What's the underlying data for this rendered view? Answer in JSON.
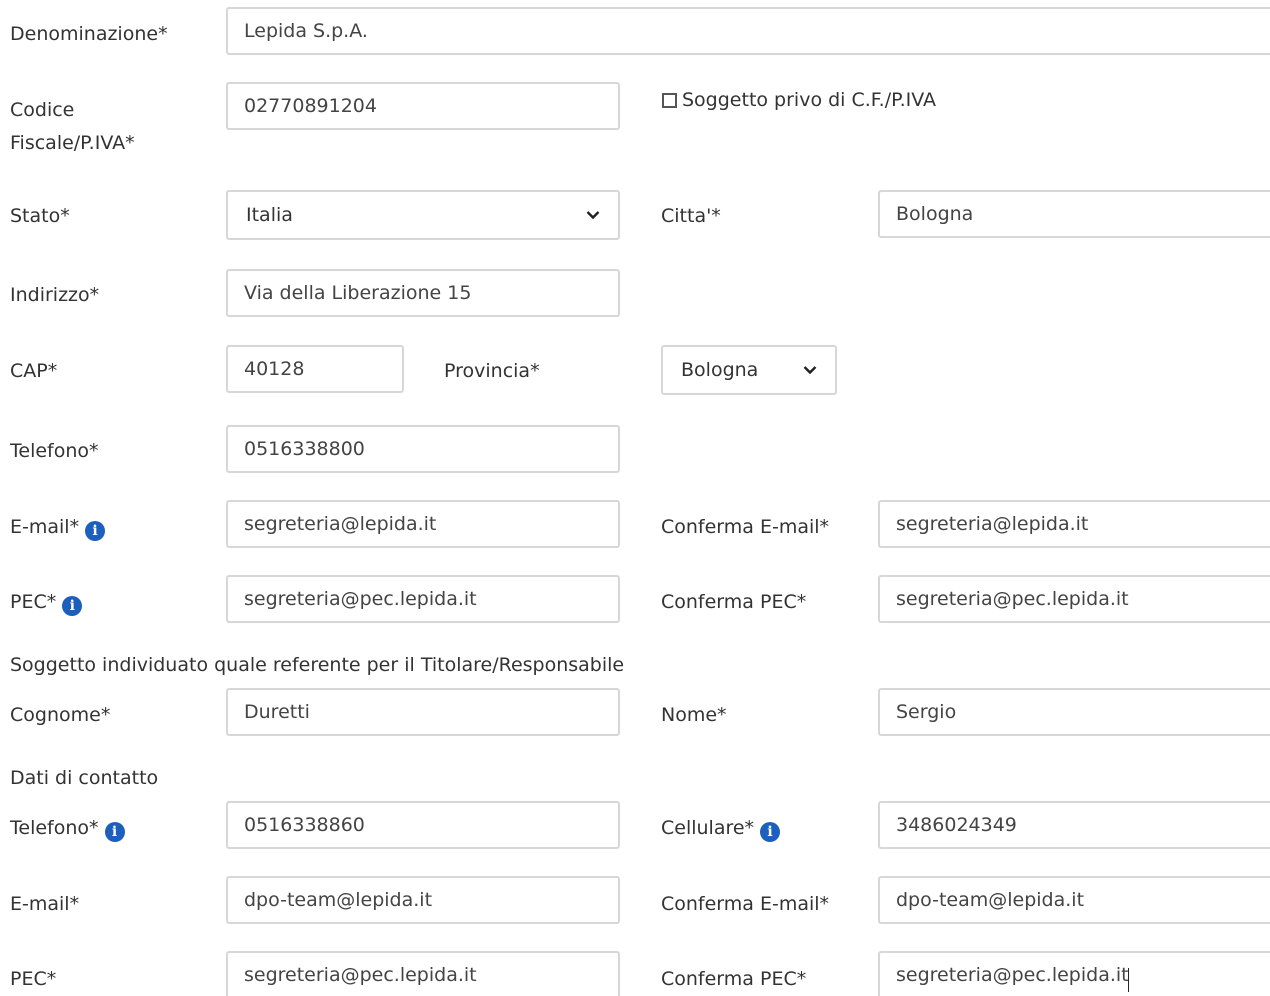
{
  "ente": {
    "denominazione": {
      "label": "Denominazione*",
      "value": "Lepida S.p.A."
    },
    "codice_fiscale": {
      "label": "Codice Fiscale/P.IVA*",
      "value": "02770891204"
    },
    "privo_cf": {
      "label": "Soggetto privo di C.F./P.IVA",
      "checked": false
    },
    "stato": {
      "label": "Stato*",
      "value": "Italia"
    },
    "citta": {
      "label": "Citta'*",
      "value": "Bologna"
    },
    "indirizzo": {
      "label": "Indirizzo*",
      "value": "Via della Liberazione 15"
    },
    "cap": {
      "label": "CAP*",
      "value": "40128"
    },
    "provincia": {
      "label": "Provincia*",
      "value": "Bologna"
    },
    "telefono": {
      "label": "Telefono*",
      "value": "0516338800"
    },
    "email": {
      "label": "E-mail*",
      "value": "segreteria@lepida.it"
    },
    "conferma_email": {
      "label": "Conferma E-mail*",
      "value": "segreteria@lepida.it"
    },
    "pec": {
      "label": "PEC*",
      "value": "segreteria@pec.lepida.it"
    },
    "conferma_pec": {
      "label": "Conferma PEC*",
      "value": "segreteria@pec.lepida.it"
    }
  },
  "referente": {
    "heading": "Soggetto individuato quale referente per il Titolare/Responsabile",
    "cognome": {
      "label": "Cognome*",
      "value": "Duretti"
    },
    "nome": {
      "label": "Nome*",
      "value": "Sergio"
    }
  },
  "contatti": {
    "heading": "Dati di contatto",
    "telefono": {
      "label": "Telefono*",
      "value": "0516338860"
    },
    "cellulare": {
      "label": "Cellulare*",
      "value": "3486024349"
    },
    "email": {
      "label": "E-mail*",
      "value": "dpo-team@lepida.it"
    },
    "conferma_email": {
      "label": "Conferma E-mail*",
      "value": "dpo-team@lepida.it"
    },
    "pec": {
      "label": "PEC*",
      "value": "segreteria@pec.lepida.it"
    },
    "conferma_pec": {
      "label": "Conferma PEC*",
      "value": "segreteria@pec.lepida.it"
    }
  },
  "icons": {
    "info": "info-circle-icon",
    "chevron": "chevron-down-icon"
  },
  "colors": {
    "info_icon": "#1d5fbd",
    "border": "#d7d7d7"
  }
}
